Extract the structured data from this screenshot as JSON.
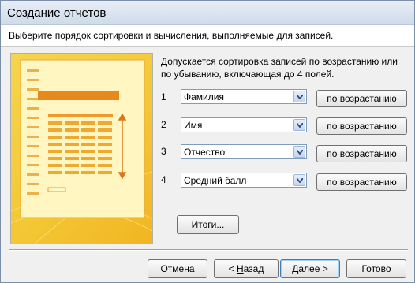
{
  "window": {
    "title": "Создание отчетов"
  },
  "header": {
    "text": "Выберите порядок сортировки и вычисления, выполняемые для записей."
  },
  "description": "Допускается сортировка записей по возрастанию или по убыванию, включающая до 4 полей.",
  "sort_rows": [
    {
      "num": "1",
      "field": "Фамилия",
      "order": "по возрастанию"
    },
    {
      "num": "2",
      "field": "Имя",
      "order": "по возрастанию"
    },
    {
      "num": "3",
      "field": "Отчество",
      "order": "по возрастанию"
    },
    {
      "num": "4",
      "field": "Средний балл",
      "order": "по возрастанию"
    }
  ],
  "totals_button": {
    "mnemonic": "И",
    "rest": "тоги..."
  },
  "footer": {
    "cancel": "Отмена",
    "back_prefix": "< ",
    "back_mnemonic": "Н",
    "back_rest": "азад",
    "next_mnemonic": "Д",
    "next_rest": "алее >",
    "finish": "Готово"
  },
  "colors": {
    "preview_bg": "#f3c836",
    "preview_bar": "#e8891e",
    "default_button_border": "#3c7fb1"
  },
  "icons": [
    "dropdown-arrow-icon",
    "report-layout-illustration"
  ]
}
